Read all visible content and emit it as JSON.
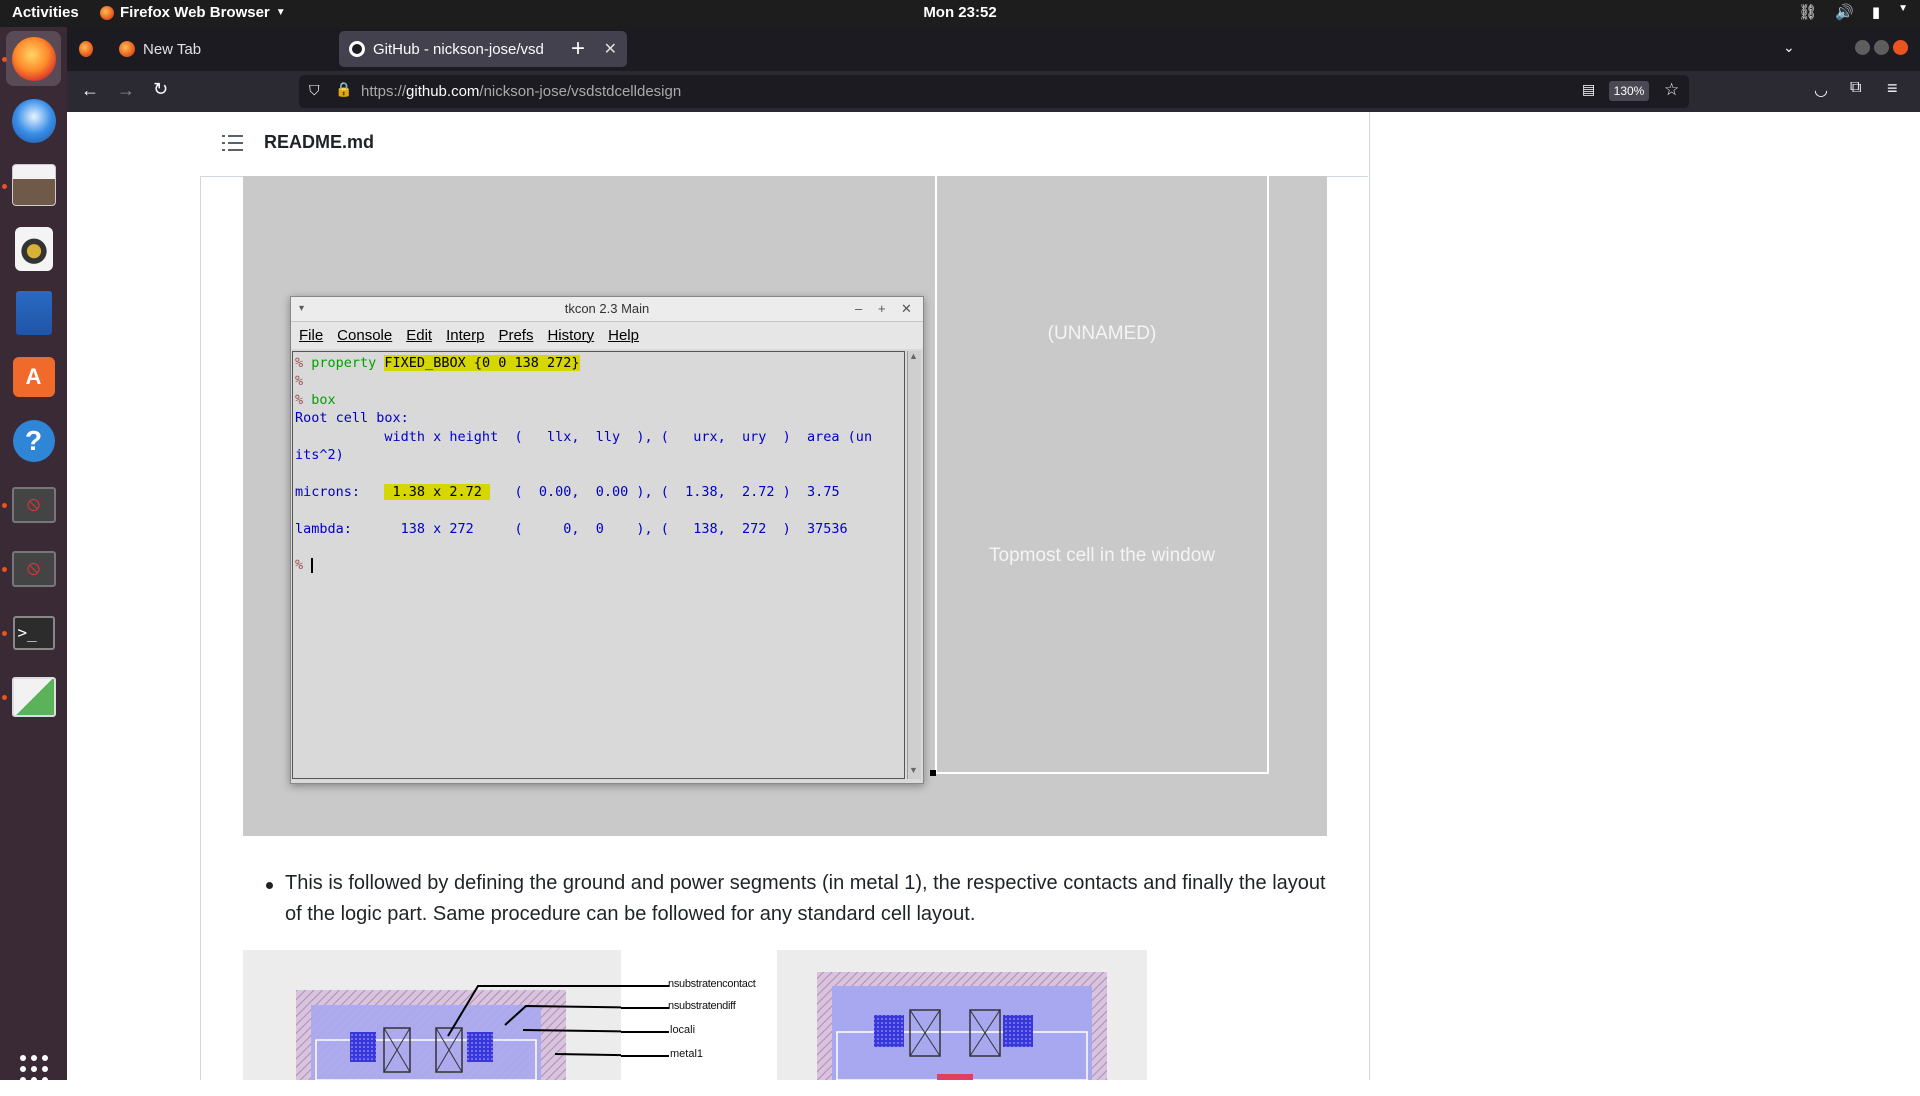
{
  "topbar": {
    "activities": "Activities",
    "app_name": "Firefox Web Browser",
    "clock": "Mon 23:52"
  },
  "dock": {
    "items": [
      "firefox-icon",
      "thunderbird-icon",
      "files-icon",
      "rhythmbox-icon",
      "writer-icon",
      "software-icon",
      "help-icon",
      "blocked-app-icon",
      "blocked-app-icon",
      "terminal-icon",
      "image-viewer-icon",
      "show-apps-icon"
    ]
  },
  "tabs": [
    {
      "title": "New Tab"
    },
    {
      "title": "GitHub - nickson-jose/vsd"
    }
  ],
  "urlbar": {
    "prefix": "https://github.com/",
    "host": "github.com",
    "path": "nickson-jose/vsdstdcelldesign",
    "zoom": "130%"
  },
  "readme": {
    "title": "README.md"
  },
  "screenshot": {
    "cell_label": "(UNNAMED)",
    "topmost_label": "Topmost cell in the window",
    "tkcon": {
      "title": "tkcon 2.3 Main",
      "menu": [
        "File",
        "Console",
        "Edit",
        "Interp",
        "Prefs",
        "History",
        "Help"
      ],
      "lines": {
        "l1_prompt": "% ",
        "l1_cmd": "property ",
        "l1_hl": "FIXED_BBOX {0 0 138 272}",
        "l2": "%",
        "l3_prompt": "% ",
        "l3_cmd": "box",
        "l4": "Root cell box:",
        "l5": "           width x height  (   llx,  lly  ), (   urx,  ury  )  area (un",
        "l6": "its^2)",
        "l7_a": "microns:   ",
        "l7_hl": " 1.38 x 2.72 ",
        "l7_b": "   (  0.00,  0.00 ), (  1.38,  2.72 )  3.75",
        "l8": "lambda:      138 x 272     (     0,  0    ), (   138,  272  )  37536",
        "l9": "% "
      }
    }
  },
  "bullet": {
    "text": "This is followed by defining the ground and power segments (in metal 1), the respective contacts and finally the layout of the logic part. Same procedure can be followed for any standard cell layout."
  },
  "layout_labels": [
    "nsubstratencontact",
    "nsubstratendiff",
    "locali",
    "metal1"
  ]
}
